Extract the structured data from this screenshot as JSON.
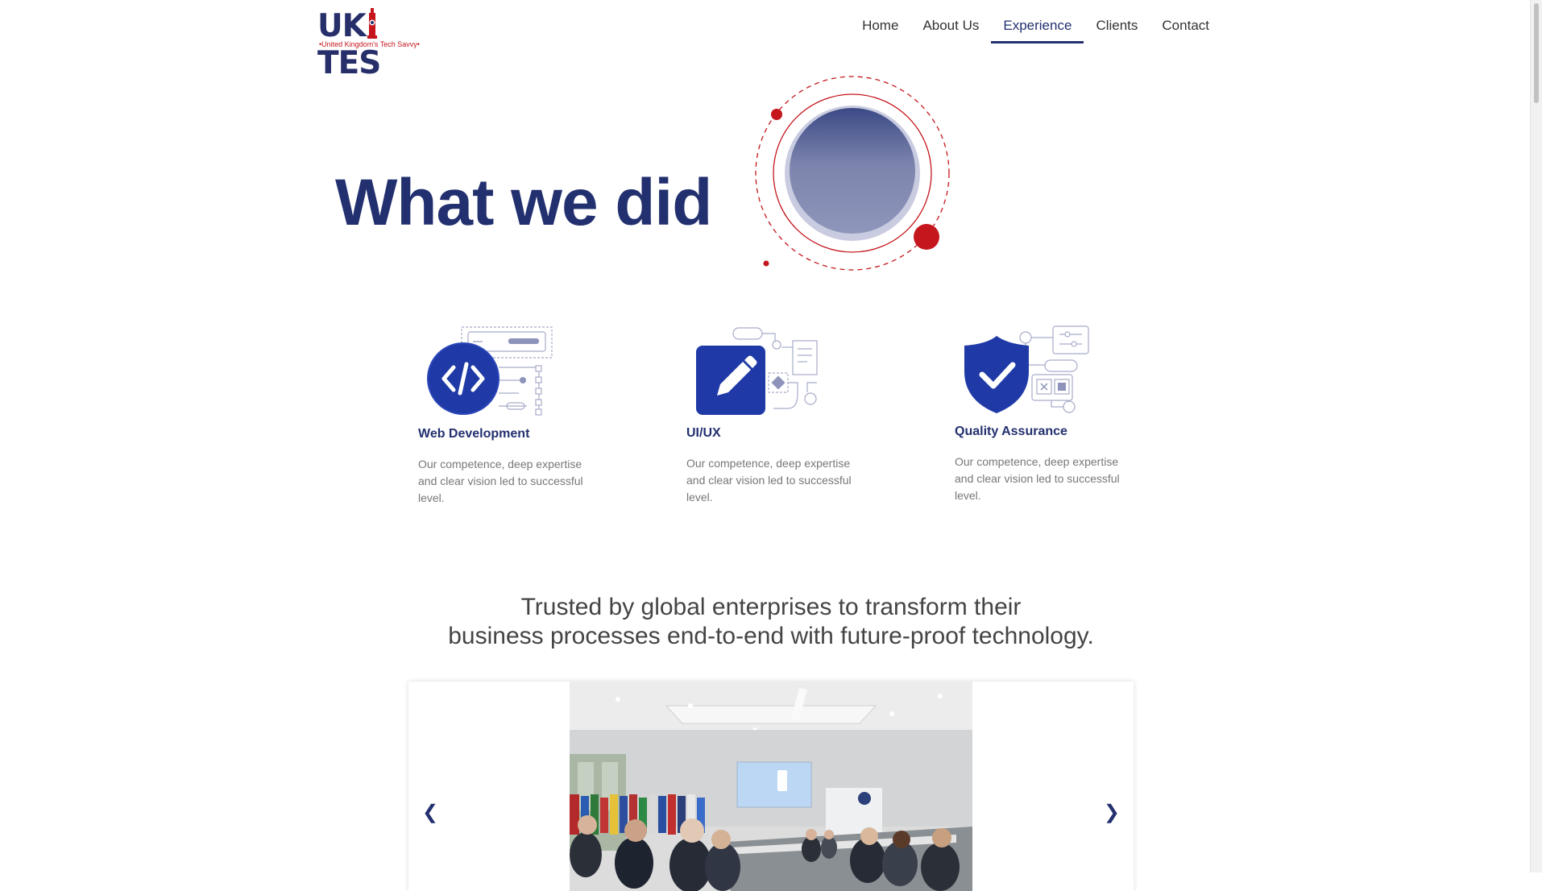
{
  "logo": {
    "text_left": "UK",
    "text_right": "TES",
    "tagline": "•United Kingdom's Tech Savvy•"
  },
  "nav": {
    "items": [
      "Home",
      "About Us",
      "Experience",
      "Clients",
      "Contact"
    ],
    "active": "Experience"
  },
  "hero": {
    "title": "What we did"
  },
  "services": [
    {
      "title": "Web Development",
      "description": "Our competence, deep expertise and clear vision led to successful level.",
      "icon": "code-icon"
    },
    {
      "title": "UI/UX",
      "description": "Our competence, deep expertise and clear vision led to successful level.",
      "icon": "pencil-icon"
    },
    {
      "title": "Quality Assurance",
      "description": "Our competence, deep expertise and clear vision led to successful level.",
      "icon": "shield-check-icon"
    }
  ],
  "trusted": {
    "line1": "Trusted by global enterprises to transform their",
    "line2": "business processes end-to-end with future-proof technology."
  },
  "carousel": {
    "prev_label": "❮",
    "next_label": "❯",
    "photo": "conference-meeting-photo"
  },
  "colors": {
    "brand_navy": "#23306f",
    "accent_red": "#c4161c",
    "icon_blue": "#1f3aa6"
  }
}
